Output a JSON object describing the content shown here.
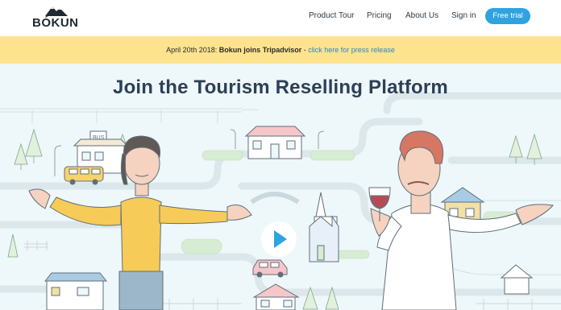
{
  "nav": {
    "logo_text": "BÓKUN",
    "links": [
      "Product Tour",
      "Pricing",
      "About Us",
      "Sign in"
    ],
    "cta": "Free trial"
  },
  "banner": {
    "date": "April 20th 2018:",
    "headline": "Bokun joins Tripadvisor",
    "separator": "-",
    "link": "click here for press release"
  },
  "hero": {
    "title": "Join the Tourism Reselling Platform",
    "bus_sign": "BUS"
  },
  "colors": {
    "accent": "#2ea3e0",
    "banner_bg": "#fde38d",
    "hero_bg": "#eef7f9",
    "title": "#2e3f56"
  }
}
